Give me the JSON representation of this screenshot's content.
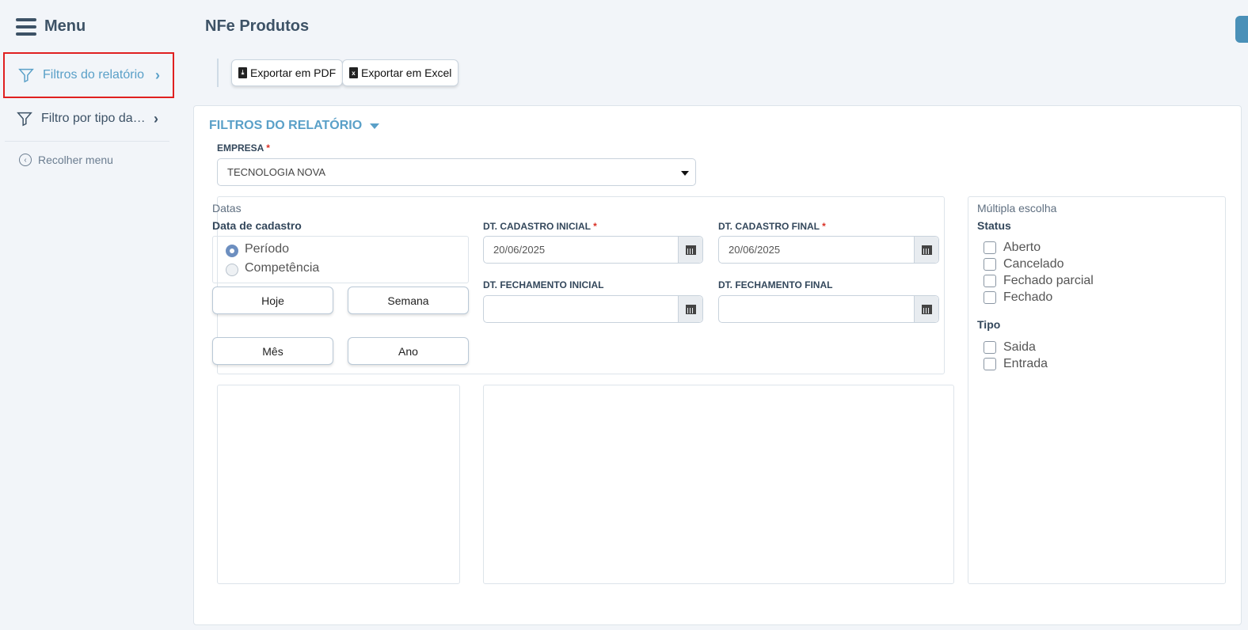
{
  "sidebar": {
    "menu_label": "Menu",
    "items": [
      {
        "label": "Filtros do relatório",
        "icon": "filter-icon",
        "active": true
      },
      {
        "label": "Filtro por tipo da nota",
        "icon": "filter-icon",
        "active": false
      }
    ],
    "collapse_label": "Recolher menu"
  },
  "header": {
    "title": "NFe Produtos",
    "export_pdf": "Exportar em PDF",
    "export_excel": "Exportar em Excel"
  },
  "filters": {
    "section_title": "FILTROS DO RELATÓRIO",
    "empresa": {
      "label": "EMPRESA",
      "required_mark": "*",
      "value": "TECNOLOGIA NOVA"
    },
    "datas": {
      "legend": "Datas",
      "subtitle": "Data de cadastro",
      "radio_options": [
        {
          "label": "Período",
          "selected": true
        },
        {
          "label": "Competência",
          "selected": false
        }
      ],
      "quick_buttons": [
        "Hoje",
        "Semana",
        "Mês",
        "Ano"
      ],
      "cadastro_inicial": {
        "label": "DT. CADASTRO INICIAL",
        "required_mark": "*",
        "value": "20/06/2025"
      },
      "cadastro_final": {
        "label": "DT. CADASTRO FINAL",
        "required_mark": "*",
        "value": "20/06/2025"
      },
      "fechamento_inicial": {
        "label": "DT. FECHAMENTO INICIAL",
        "value": ""
      },
      "fechamento_final": {
        "label": "DT. FECHAMENTO FINAL",
        "value": ""
      }
    },
    "multipla": {
      "legend": "Múltipla escolha",
      "status_title": "Status",
      "status_options": [
        "Aberto",
        "Cancelado",
        "Fechado parcial",
        "Fechado"
      ],
      "tipo_title": "Tipo",
      "tipo_options": [
        "Saida",
        "Entrada"
      ]
    }
  },
  "colors": {
    "accent": "#5aa0c8",
    "text": "#33475b",
    "required": "#d93025",
    "highlight_border": "#e02020"
  }
}
